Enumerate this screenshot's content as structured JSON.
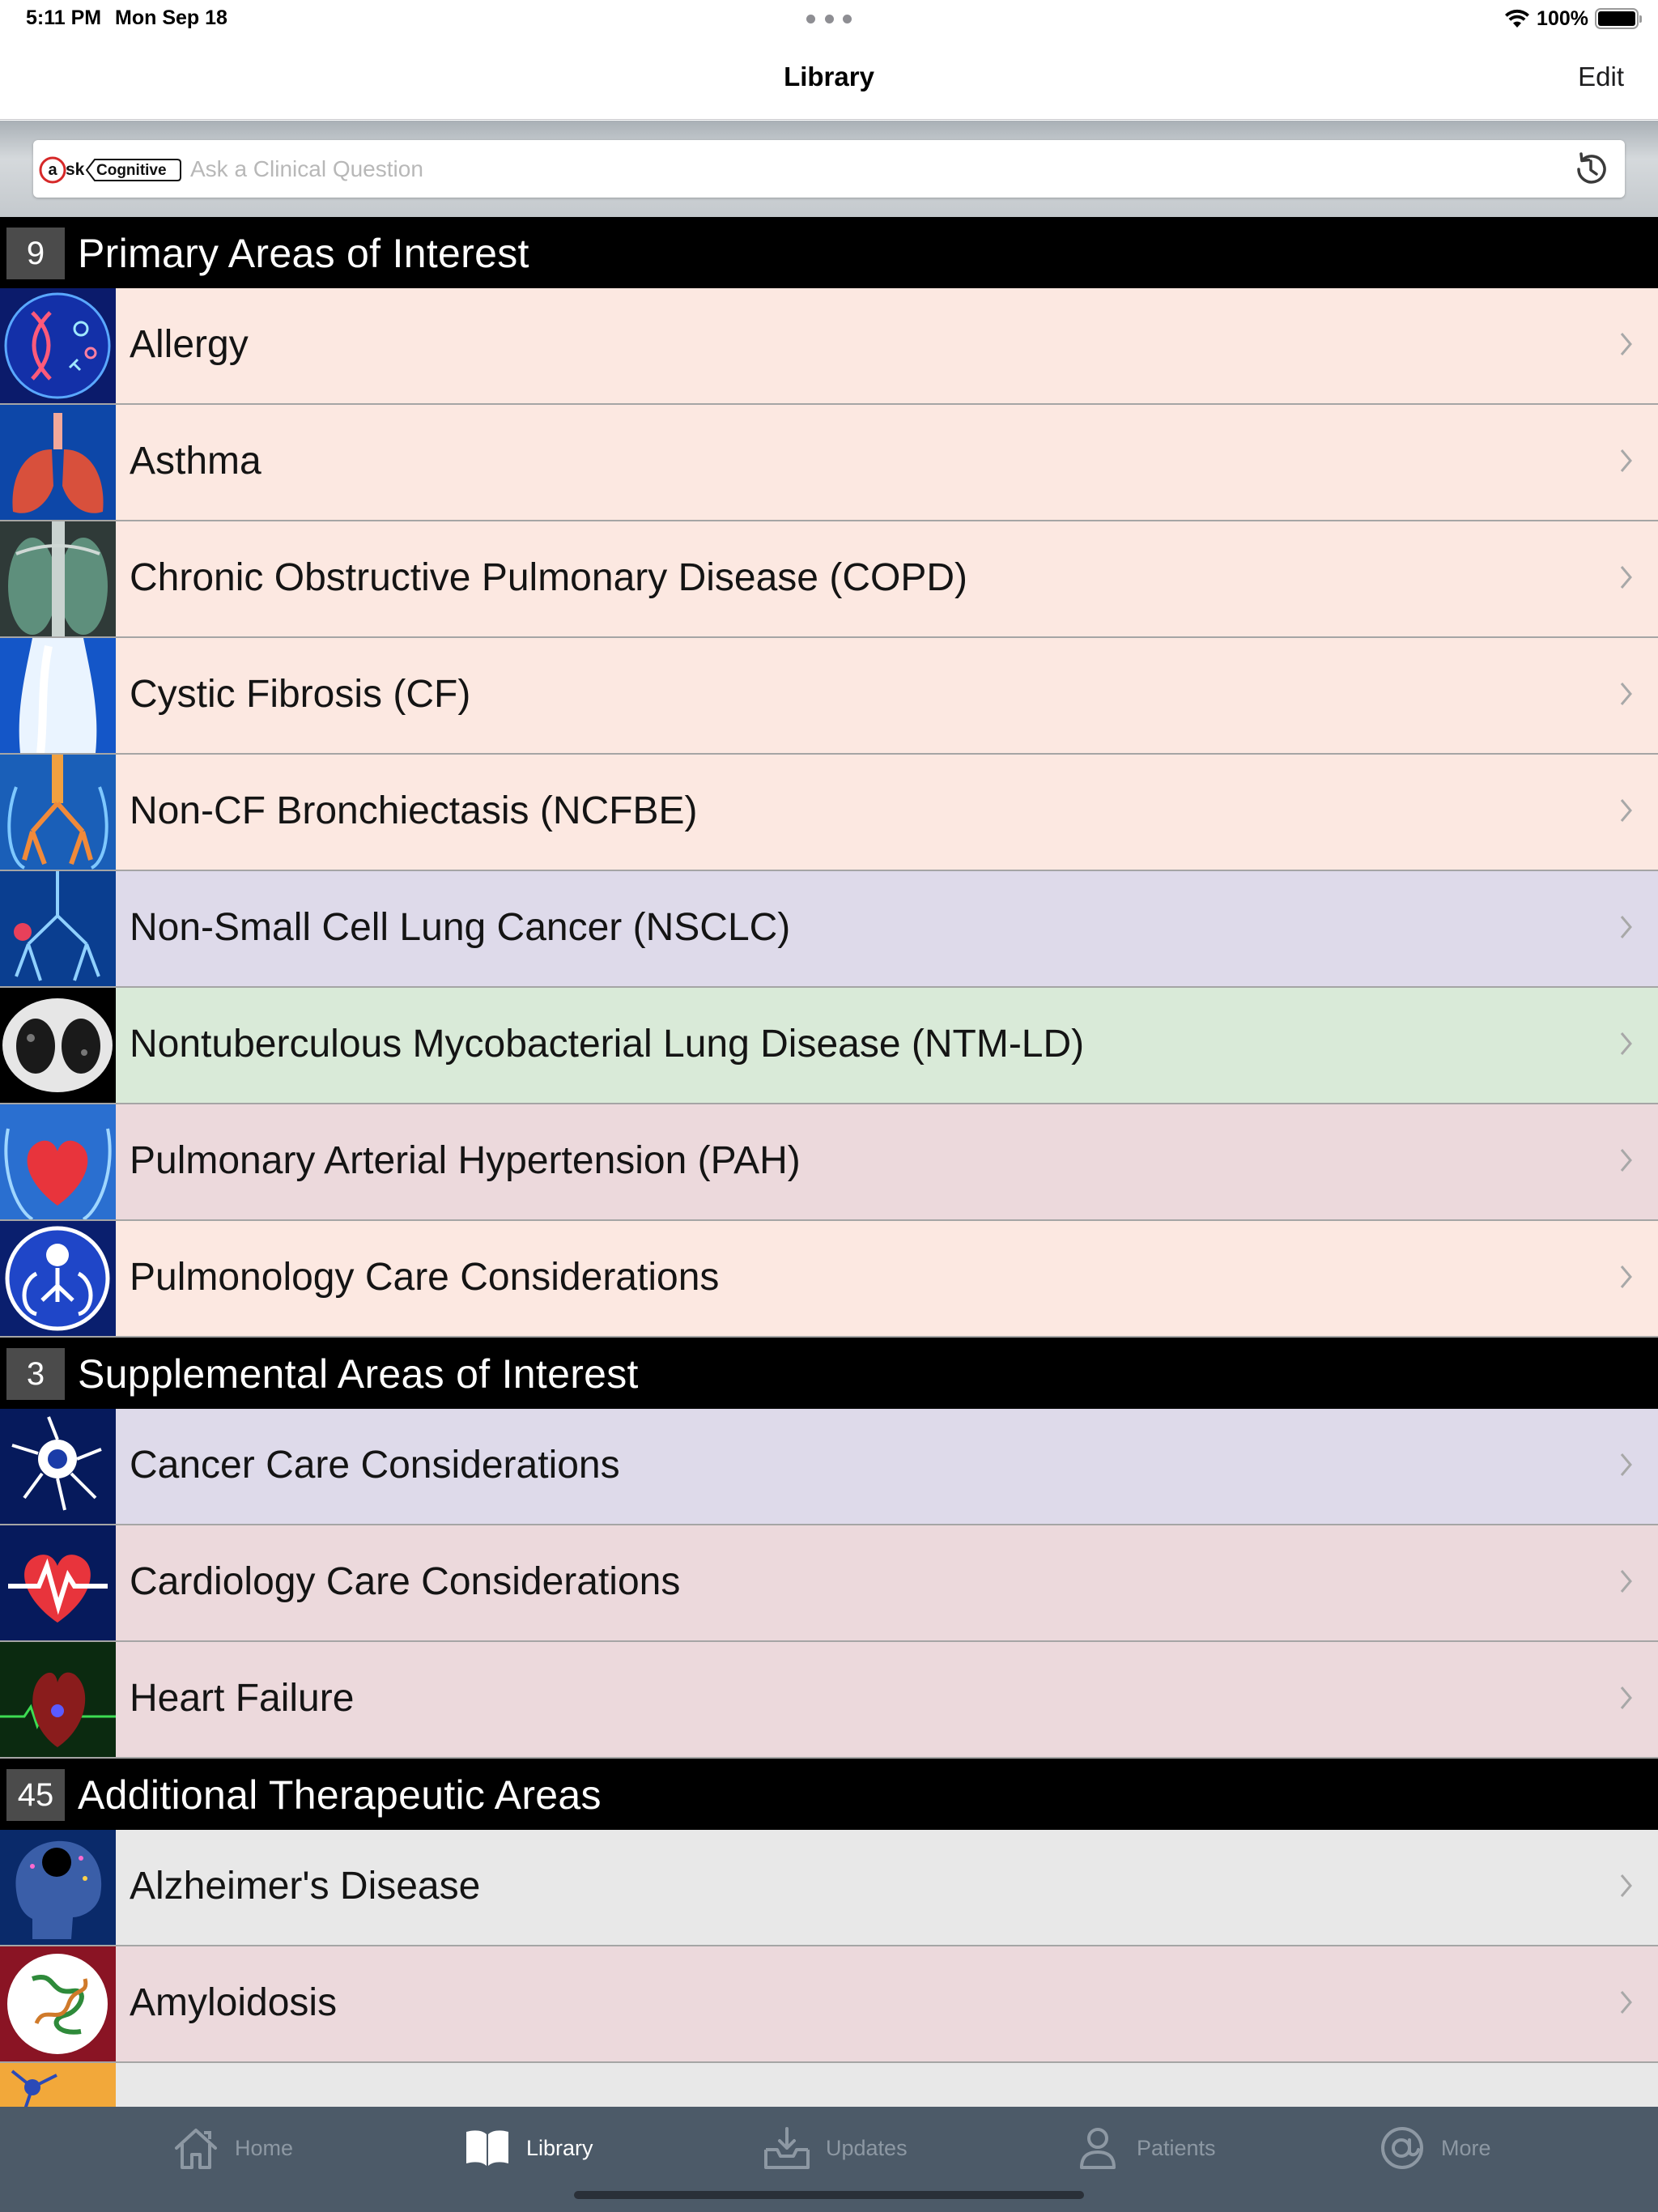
{
  "status_bar": {
    "time": "5:11 PM",
    "date": "Mon Sep 18",
    "battery": "100%"
  },
  "nav": {
    "title": "Library",
    "edit_label": "Edit"
  },
  "search": {
    "placeholder": "Ask a Clinical Question",
    "logo_letter": "a",
    "logo_sk": "sk",
    "logo_brand": "Cognitive"
  },
  "sections": [
    {
      "count": "9",
      "title": "Primary Areas of Interest",
      "items": [
        {
          "label": "Allergy",
          "color": "#fce8e1"
        },
        {
          "label": "Asthma",
          "color": "#fce8e1"
        },
        {
          "label": "Chronic Obstructive Pulmonary Disease (COPD)",
          "color": "#fce8e1"
        },
        {
          "label": "Cystic Fibrosis (CF)",
          "color": "#fce8e1"
        },
        {
          "label": "Non-CF Bronchiectasis (NCFBE)",
          "color": "#fce8e1"
        },
        {
          "label": "Non-Small Cell Lung Cancer (NSCLC)",
          "color": "#dedaea"
        },
        {
          "label": "Nontuberculous Mycobacterial Lung Disease (NTM-LD)",
          "color": "#d9ead8"
        },
        {
          "label": "Pulmonary Arterial Hypertension (PAH)",
          "color": "#ecd9dc"
        },
        {
          "label": "Pulmonology Care Considerations",
          "color": "#fce8e1"
        }
      ]
    },
    {
      "count": "3",
      "title": "Supplemental Areas of Interest",
      "items": [
        {
          "label": "Cancer Care Considerations",
          "color": "#dedaea"
        },
        {
          "label": "Cardiology Care Considerations",
          "color": "#ecd9dc"
        },
        {
          "label": "Heart Failure",
          "color": "#ecd9dc"
        }
      ]
    },
    {
      "count": "45",
      "title": "Additional Therapeutic Areas",
      "items": [
        {
          "label": "Alzheimer's Disease",
          "color": "#e8e8e8"
        },
        {
          "label": "Amyloidosis",
          "color": "#ecd9dc"
        },
        {
          "label": "",
          "color": "#e8e8e8"
        }
      ]
    }
  ],
  "tabs": [
    {
      "label": "Home",
      "icon": "home-icon",
      "active": false
    },
    {
      "label": "Library",
      "icon": "book-icon",
      "active": true
    },
    {
      "label": "Updates",
      "icon": "updates-inbox-icon",
      "active": false
    },
    {
      "label": "Patients",
      "icon": "person-icon",
      "active": false
    },
    {
      "label": "More",
      "icon": "at-sign-icon",
      "active": false
    }
  ],
  "colors": {
    "tabbar": "#4c5a68",
    "header": "#000000",
    "tab_active": "#ffffff",
    "tab_inactive": "#8d98a3"
  }
}
